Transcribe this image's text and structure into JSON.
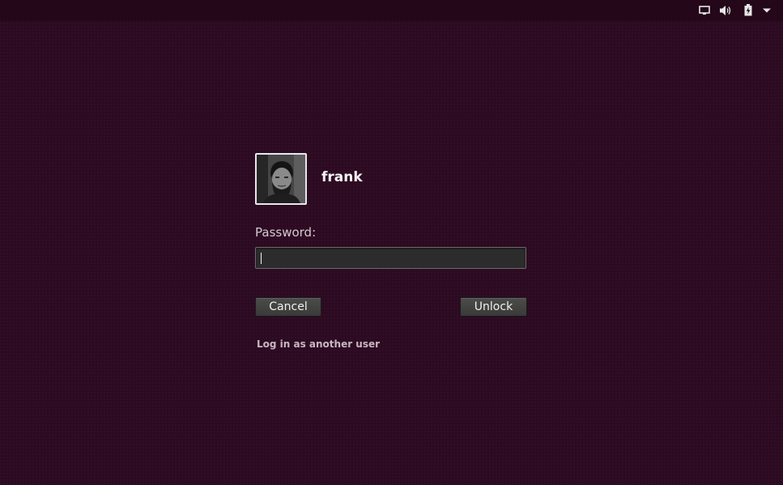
{
  "panel": {
    "indicators": [
      "display-icon",
      "volume-icon",
      "battery-charging-icon",
      "menu-arrow-icon"
    ]
  },
  "user": {
    "name": "frank",
    "avatar": "user-photo"
  },
  "form": {
    "password_label": "Password:",
    "password_value": ""
  },
  "buttons": {
    "cancel_label": "Cancel",
    "unlock_label": "Unlock"
  },
  "links": {
    "another_user_label": "Log in as another user"
  },
  "colors": {
    "background": "#2c0a21",
    "panel": "#240719",
    "button": "#42423f"
  }
}
